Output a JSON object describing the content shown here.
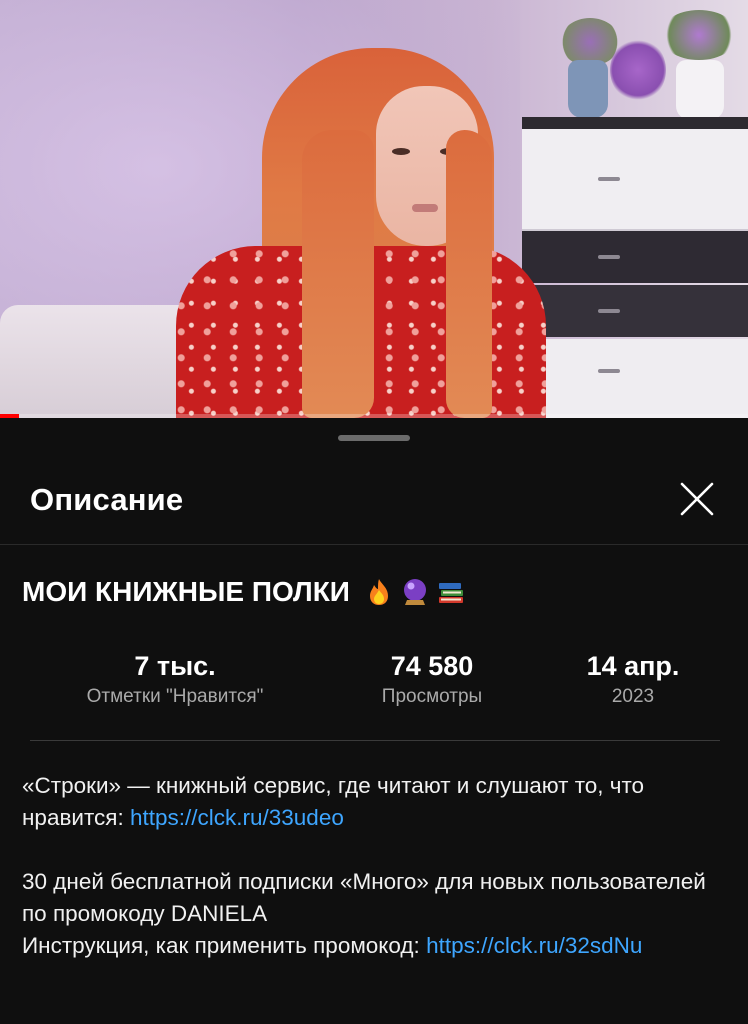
{
  "player": {
    "progress_fraction": 0.026
  },
  "sheet": {
    "title": "Описание",
    "video_title": "МОИ КНИЖНЫЕ ПОЛКИ",
    "title_emojis": [
      "fire-emoji",
      "crystal-ball-emoji",
      "books-emoji"
    ],
    "stats": {
      "likes_value": "7 тыс.",
      "likes_label": "Отметки \"Нравится\"",
      "views_value": "74 580",
      "views_label": "Просмотры",
      "date_value": "14 апр.",
      "date_year": "2023"
    },
    "description": {
      "p1_text": "«Строки» — книжный сервис, где читают и слушают то, что нравится: ",
      "p1_link": "https://clck.ru/33udeo",
      "p2_line1": "30 дней бесплатной подписки «Много» для новых пользователей по промокоду DANIELA",
      "p2_line2_text": "Инструкция, как применить промокод: ",
      "p2_link": "https://clck.ru/32sdNu"
    }
  },
  "colors": {
    "background": "#0f0f0f",
    "link": "#3ea6ff",
    "secondary_text": "#aaaaaa",
    "progress": "#ff0000"
  }
}
